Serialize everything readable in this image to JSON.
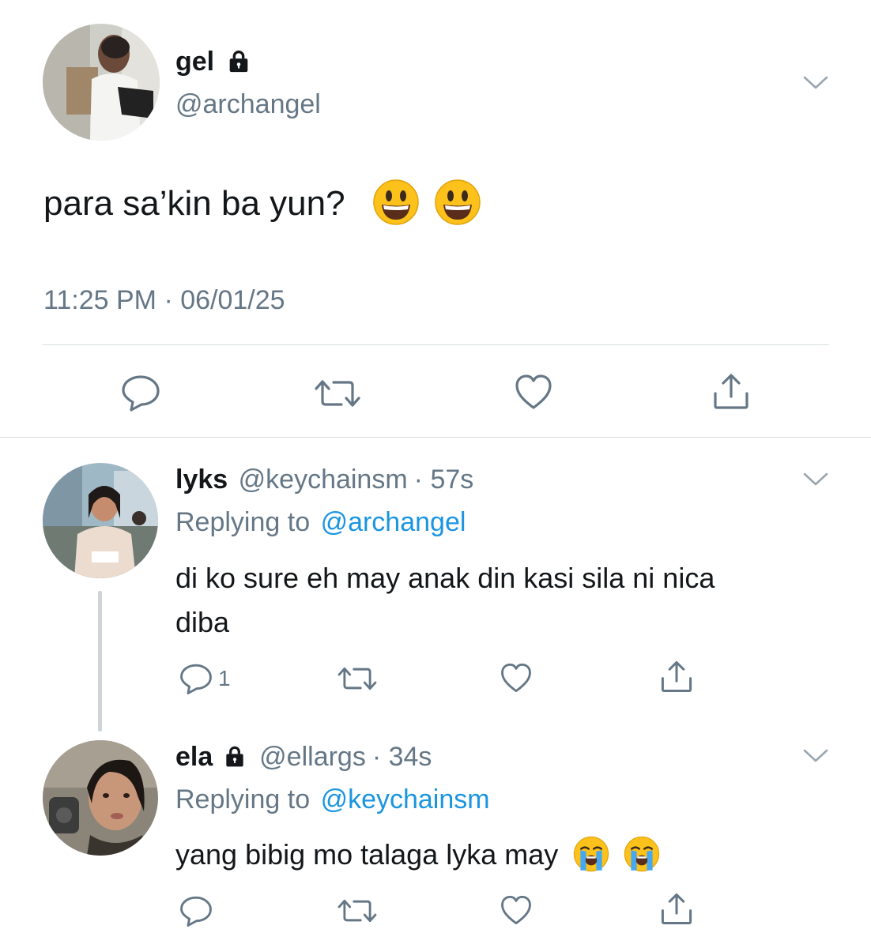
{
  "main_tweet": {
    "display_name": "gel",
    "handle": "@archangel",
    "text": "para sa’kin ba yun?",
    "emoji": [
      "grinning-face",
      "grinning-face"
    ],
    "timestamp": "11:25 PM · 06/01/25",
    "protected": true
  },
  "replies": [
    {
      "display_name": "lyks",
      "handle": "@keychainsm",
      "time": "· 57s",
      "replying_label": "Replying to",
      "replying_to": "@archangel",
      "text_line1": "di ko sure eh may anak din kasi sila ni nica",
      "text_line2": "diba",
      "reply_count": "1",
      "protected": false
    },
    {
      "display_name": "ela",
      "handle": "@ellargs",
      "time": "· 34s",
      "replying_label": "Replying to",
      "replying_to": "@keychainsm",
      "text": "yang bibig mo talaga lyka may",
      "emoji": [
        "loudly-crying-face",
        "loudly-crying-face"
      ],
      "protected": true
    }
  ],
  "colors": {
    "text": "#14171a",
    "secondary": "#657786",
    "link": "#1b95e0",
    "divider": "#d9dee2",
    "icon": "#657786"
  },
  "icons": [
    "chevron-down-icon",
    "lock-icon",
    "reply-icon",
    "retweet-icon",
    "like-icon",
    "share-icon"
  ]
}
